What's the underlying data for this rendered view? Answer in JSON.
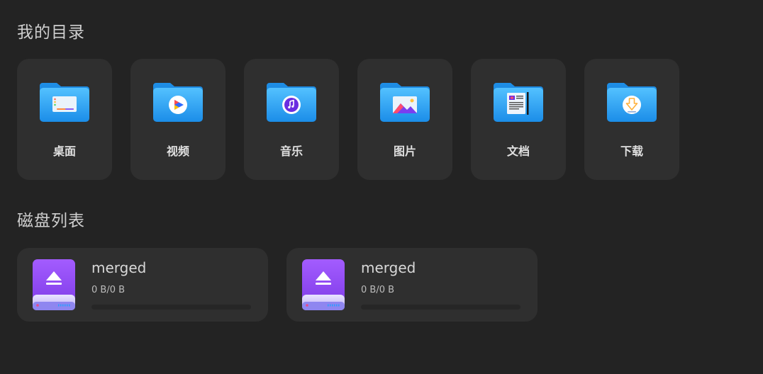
{
  "directories": {
    "title": "我的目录",
    "items": [
      {
        "label": "桌面",
        "icon": "desktop-folder-icon"
      },
      {
        "label": "视频",
        "icon": "video-folder-icon"
      },
      {
        "label": "音乐",
        "icon": "music-folder-icon"
      },
      {
        "label": "图片",
        "icon": "pictures-folder-icon"
      },
      {
        "label": "文档",
        "icon": "documents-folder-icon"
      },
      {
        "label": "下载",
        "icon": "downloads-folder-icon"
      }
    ]
  },
  "disks": {
    "title": "磁盘列表",
    "items": [
      {
        "name": "merged",
        "size": "0 B/0 B",
        "usage_fraction": 0,
        "icon": "eject-drive-icon"
      },
      {
        "name": "merged",
        "size": "0 B/0 B",
        "usage_fraction": 0,
        "icon": "eject-drive-icon"
      }
    ]
  },
  "colors": {
    "background": "#232323",
    "card": "#2f2f2f",
    "folder_blue": "#2a9cf0",
    "drive_purple": "#9b4ef5"
  }
}
